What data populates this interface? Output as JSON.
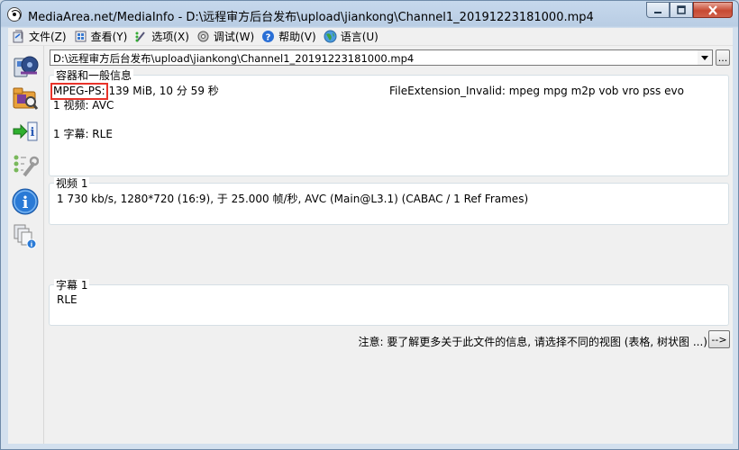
{
  "window": {
    "title": "MediaArea.net/MediaInfo - D:\\远程审方后台发布\\upload\\jiankong\\Channel1_20191223181000.mp4"
  },
  "menu": {
    "items": [
      {
        "label": "文件(Z)",
        "icon": "file-icon"
      },
      {
        "label": "查看(Y)",
        "icon": "view-icon"
      },
      {
        "label": "选项(X)",
        "icon": "options-icon"
      },
      {
        "label": "调试(W)",
        "icon": "debug-icon"
      },
      {
        "label": "帮助(V)",
        "icon": "help-icon"
      },
      {
        "label": "语言(U)",
        "icon": "language-icon"
      }
    ]
  },
  "sidebar": {
    "buttons": [
      "open-file-icon",
      "open-folder-icon",
      "export-icon",
      "preferences-icon",
      "about-icon",
      "knowledge-icon"
    ]
  },
  "file": {
    "path": "D:\\远程审方后台发布\\upload\\jiankong\\Channel1_20191223181000.mp4",
    "browse_label": "..."
  },
  "general": {
    "title": "容器和一般信息",
    "format": "MPEG-PS:",
    "format_value": " 139 MiB, 10 分 59 秒",
    "extension_invalid": "FileExtension_Invalid: mpeg mpg m2p vob vro pss evo",
    "video_count": "1 视频: AVC",
    "text_count": "1 字幕: RLE"
  },
  "video": {
    "title": "视频 1",
    "details": "1 730 kb/s, 1280*720 (16:9), 于 25.000 帧/秒, AVC (Main@L3.1) (CABAC / 1 Ref Frames)"
  },
  "subtitle": {
    "title": "字幕 1",
    "details": "RLE"
  },
  "footer": {
    "note": "注意: 要了解更多关于此文件的信息, 请选择不同的视图 (表格, 树状图 ...)",
    "more_label": "-->"
  },
  "colors": {
    "highlight": "#e8332a",
    "titlebar": "#b9cde4"
  }
}
